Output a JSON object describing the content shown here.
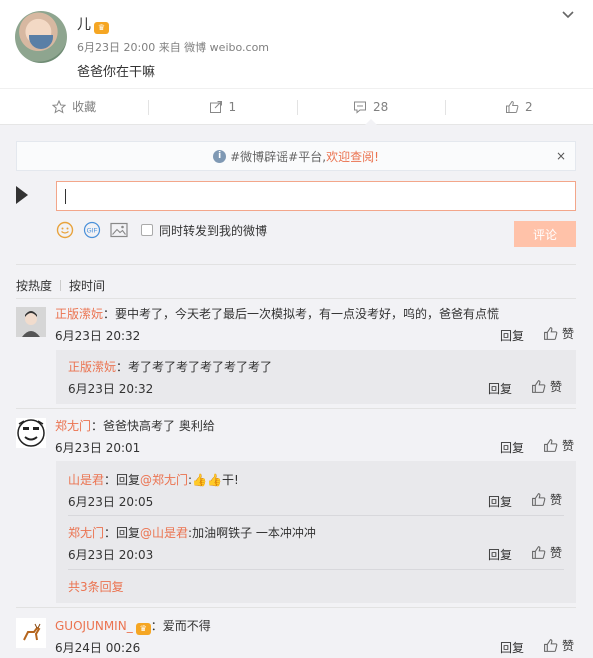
{
  "post": {
    "user_name": "儿",
    "vip_badge": "♛",
    "meta": "6月23日 20:00 来自 微博 weibo.com",
    "text": "爸爸你在干嘛"
  },
  "actions": [
    {
      "icon": "star-icon",
      "label": "收藏"
    },
    {
      "icon": "share-icon",
      "label": "1"
    },
    {
      "icon": "comment-icon",
      "label": "28"
    },
    {
      "icon": "thumb-up-icon",
      "label": "2"
    }
  ],
  "notice": {
    "prefix": "#微博辟谣#平台,",
    "link": "欢迎查阅!",
    "close": "×"
  },
  "compose": {
    "repost_label": "同时转发到我的微博",
    "submit_label": "评论"
  },
  "sort": {
    "by_hot": "按热度",
    "by_time": "按时间"
  },
  "comments": [
    {
      "user": "正版潆妧",
      "text": "：要中考了，今天老了最后一次模拟考，有一点没考好，呜的，爸爸有点慌",
      "time": "6月23日 20:32",
      "reply": "回复",
      "like": "赞",
      "replies": [
        {
          "user": "正版潆妧",
          "text": "：考了考了考了考了考了考了",
          "time": "6月23日 20:32",
          "reply": "回复",
          "like": "赞"
        }
      ]
    },
    {
      "user": "郑尢门",
      "text": "：爸爸快高考了 奥利给",
      "time": "6月23日 20:01",
      "reply": "回复",
      "like": "赞",
      "replies": [
        {
          "user": "山是君",
          "pre": "：回复",
          "mention": "@郑尢门",
          "text": ":👍👍干!",
          "time": "6月23日 20:05",
          "reply": "回复",
          "like": "赞"
        },
        {
          "user": "郑尢门",
          "pre": "：回复",
          "mention": "@山是君",
          "text": ":加油啊铁子 一本冲冲冲",
          "time": "6月23日 20:03",
          "reply": "回复",
          "like": "赞"
        }
      ],
      "more": "共3条回复"
    },
    {
      "user": "GUOJUNMIN_",
      "badge": "♛",
      "text": "：爱而不得",
      "time": "6月24日 00:26",
      "reply": "回复",
      "like": "赞"
    }
  ],
  "colors": {
    "accent": "#eb7350",
    "comment_bg": "#f2f2f5",
    "input_border": "#f3a68a",
    "submit_bg": "#ffc2a9"
  }
}
